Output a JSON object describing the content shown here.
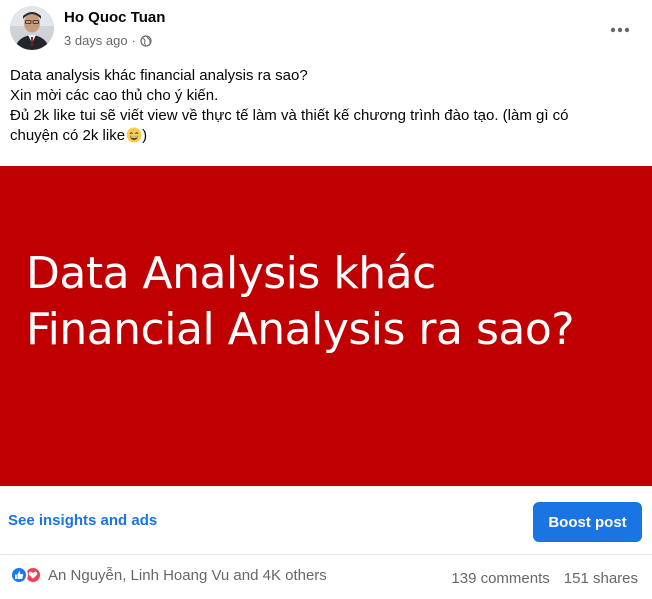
{
  "post": {
    "author": "Ho Quoc Tuan",
    "time": "3 days ago",
    "separator": "·",
    "audience_icon": "globe-icon",
    "more_icon": "more-options-icon",
    "text_lines": [
      "Data analysis khác financial analysis ra sao?",
      "Xin mời các cao thủ cho ý kiến.",
      "Đủ 2k like tui sẽ viết view về thực tế làm và thiết kế chương trình đào tạo. (làm gì có",
      "chuyện có 2k like",
      ")"
    ],
    "emoji_icon": "grinning-face-emoji-icon",
    "banner": {
      "background_color": "#c00000",
      "title_lines": [
        "Data Analysis khác",
        "Financial Analysis ra sao?"
      ]
    }
  },
  "actions": {
    "insights_label": "See insights and ads",
    "boost_label": "Boost post",
    "accent_color": "#1b74e4"
  },
  "footer": {
    "reaction_icons": [
      "like-icon",
      "love-icon"
    ],
    "reactors": "An Nguyễn, Linh Hoang Vu and 4K others",
    "comments": "139 comments",
    "shares": "151 shares"
  }
}
